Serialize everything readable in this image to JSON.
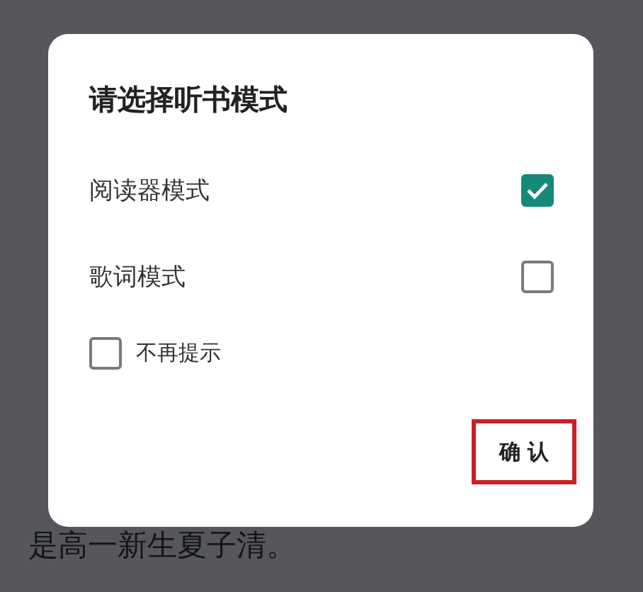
{
  "background_text": [
    {
      "left": "是高一新生夏子清。"
    }
  ],
  "dialog": {
    "title": "请选择听书模式",
    "options": [
      {
        "label": "阅读器模式",
        "checked": true
      },
      {
        "label": "歌词模式",
        "checked": false
      }
    ],
    "dont_show_again": {
      "label": "不再提示",
      "checked": false
    },
    "confirm_button": {
      "label": "确 认",
      "highlighted": true
    }
  }
}
